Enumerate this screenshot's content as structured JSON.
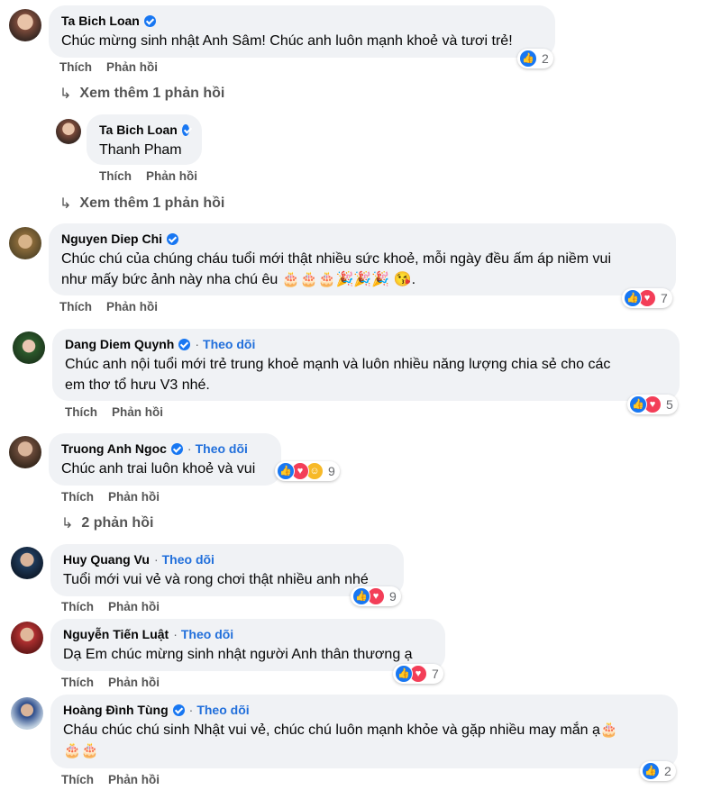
{
  "labels": {
    "like": "Thích",
    "reply": "Phản hồi",
    "follow": "Theo dõi"
  },
  "comments": [
    {
      "name": "Ta Bich Loan",
      "text": "Chúc mừng sinh nhật Anh Sâm! Chúc anh luôn mạnh khoẻ và tươi trẻ!",
      "reactions": "2"
    },
    {
      "more": "Xem thêm 1 phản hồi"
    },
    {
      "name": "Ta Bich Loan",
      "text": "Thanh Pham"
    },
    {
      "more": "Xem thêm 1 phản hồi"
    },
    {
      "name": "Nguyen Diep Chi",
      "line1": "Chúc chú của chúng cháu tuổi mới thật nhiều sức khoẻ, mỗi ngày đều ấm áp niềm vui",
      "line2": "như mấy bức ảnh này nha chú êu",
      "emojis": "🎂🎂🎂🎉🎉🎉 😘.",
      "reactions": "7"
    },
    {
      "name": "Dang Diem Quynh",
      "line1": "Chúc anh nội tuổi mới trẻ trung khoẻ mạnh và luôn nhiều năng lượng chia sẻ cho các",
      "line2": "em thơ tổ hưu V3 nhé.",
      "reactions": "5"
    },
    {
      "name": "Truong Anh Ngoc",
      "text": "Chúc anh trai luôn khoẻ và vui",
      "reactions": "9"
    },
    {
      "more": "2 phản hồi"
    },
    {
      "name": "Huy Quang Vu",
      "text": "Tuổi mới vui vẻ và rong chơi thật nhiều anh nhé",
      "reactions": "9"
    },
    {
      "name": "Nguyễn Tiến Luật",
      "text": "Dạ Em chúc mừng sinh nhật người Anh thân thương ạ",
      "reactions": "7"
    },
    {
      "name": "Hoàng Đình Tùng",
      "text": "Cháu chúc chú sinh Nhật vui vẻ, chúc chú luôn mạnh khỏe và gặp nhiều may mắn ạ🎂",
      "emojis": "🎂🎂",
      "reactions": "2"
    }
  ]
}
